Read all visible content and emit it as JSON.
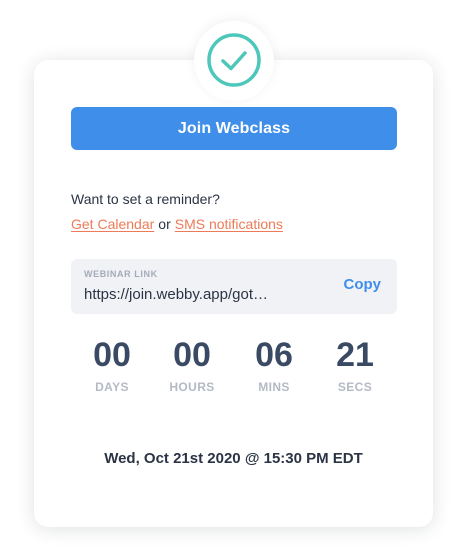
{
  "colors": {
    "accent_blue": "#3f8fea",
    "link_orange": "#ee7a57",
    "check_teal": "#4cc7b9",
    "countdown_text": "#3a4a64"
  },
  "badge": {
    "icon": "check-circle-icon"
  },
  "join_button": {
    "label": "Join Webclass"
  },
  "reminder": {
    "question": "Want to set a reminder?",
    "calendar_link": "Get Calendar",
    "separator": "or",
    "sms_link": "SMS notifications"
  },
  "webinar_link": {
    "label": "WEBINAR LINK",
    "url": "https://join.webby.app/got…",
    "copy_label": "Copy"
  },
  "countdown": [
    {
      "value": "00",
      "label": "DAYS"
    },
    {
      "value": "00",
      "label": "HOURS"
    },
    {
      "value": "06",
      "label": "MINS"
    },
    {
      "value": "21",
      "label": "SECS"
    }
  ],
  "event_date": "Wed, Oct 21st 2020 @ 15:30 PM EDT"
}
